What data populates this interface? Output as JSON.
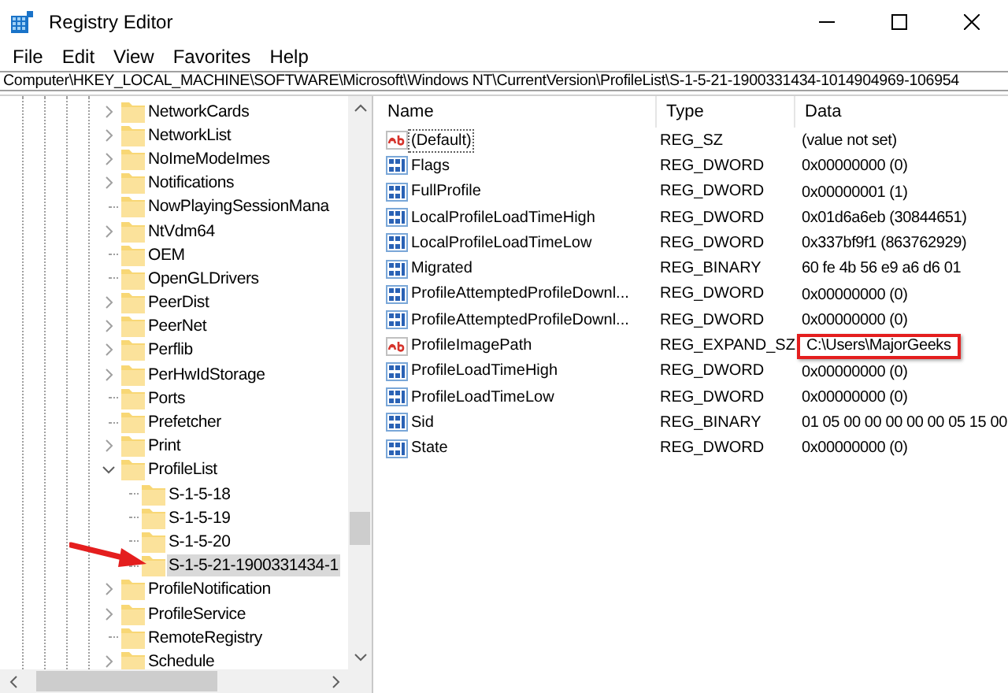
{
  "window": {
    "title": "Registry Editor"
  },
  "menu": [
    "File",
    "Edit",
    "View",
    "Favorites",
    "Help"
  ],
  "address": "Computer\\HKEY_LOCAL_MACHINE\\SOFTWARE\\Microsoft\\Windows NT\\CurrentVersion\\ProfileList\\S-1-5-21-1900331434-1014904969-106954",
  "tree": [
    {
      "label": "NetworkCards",
      "expanded": false,
      "selected": false
    },
    {
      "label": "NetworkList",
      "expanded": false,
      "selected": false
    },
    {
      "label": "NoImeModeImes",
      "expanded": false,
      "selected": false
    },
    {
      "label": "Notifications",
      "expanded": false,
      "selected": false
    },
    {
      "label": "NowPlayingSessionMana",
      "selected": false
    },
    {
      "label": "NtVdm64",
      "expanded": false,
      "selected": false
    },
    {
      "label": "OEM",
      "selected": false
    },
    {
      "label": "OpenGLDrivers",
      "selected": false
    },
    {
      "label": "PeerDist",
      "expanded": false,
      "selected": false
    },
    {
      "label": "PeerNet",
      "expanded": false,
      "selected": false
    },
    {
      "label": "Perflib",
      "expanded": false,
      "selected": false
    },
    {
      "label": "PerHwIdStorage",
      "expanded": false,
      "selected": false
    },
    {
      "label": "Ports",
      "selected": false
    },
    {
      "label": "Prefetcher",
      "selected": false
    },
    {
      "label": "Print",
      "expanded": false,
      "selected": false
    },
    {
      "label": "ProfileList",
      "expanded": true,
      "selected": false,
      "children": [
        {
          "label": "S-1-5-18",
          "selected": false
        },
        {
          "label": "S-1-5-19",
          "selected": false
        },
        {
          "label": "S-1-5-20",
          "selected": false
        },
        {
          "label": "S-1-5-21-1900331434-1",
          "selected": true
        }
      ]
    },
    {
      "label": "ProfileNotification",
      "expanded": false,
      "selected": false
    },
    {
      "label": "ProfileService",
      "expanded": false,
      "selected": false
    },
    {
      "label": "RemoteRegistry",
      "selected": false
    },
    {
      "label": "Schedule",
      "expanded": false,
      "selected": false
    }
  ],
  "annotations": [
    {
      "kind": "arrow"
    }
  ],
  "values": {
    "columns": [
      "Name",
      "Type",
      "Data"
    ],
    "rows": [
      {
        "kind": "string",
        "name": "(Default)",
        "type": "REG_SZ",
        "data": "(value not set)",
        "focused": true,
        "highlighted": false
      },
      {
        "kind": "binary",
        "name": "Flags",
        "type": "REG_DWORD",
        "data": "0x00000000 (0)",
        "focused": false,
        "highlighted": false
      },
      {
        "kind": "binary",
        "name": "FullProfile",
        "type": "REG_DWORD",
        "data": "0x00000001 (1)",
        "focused": false,
        "highlighted": false
      },
      {
        "kind": "binary",
        "name": "LocalProfileLoadTimeHigh",
        "type": "REG_DWORD",
        "data": "0x01d6a6eb (30844651)",
        "focused": false,
        "highlighted": false
      },
      {
        "kind": "binary",
        "name": "LocalProfileLoadTimeLow",
        "type": "REG_DWORD",
        "data": "0x337bf9f1 (863762929)",
        "focused": false,
        "highlighted": false
      },
      {
        "kind": "binary",
        "name": "Migrated",
        "type": "REG_BINARY",
        "data": "60 fe 4b 56 e9 a6 d6 01",
        "focused": false,
        "highlighted": false
      },
      {
        "kind": "binary",
        "name": "ProfileAttemptedProfileDownl...",
        "type": "REG_DWORD",
        "data": "0x00000000 (0)",
        "focused": false,
        "highlighted": false
      },
      {
        "kind": "binary",
        "name": "ProfileAttemptedProfileDownl...",
        "type": "REG_DWORD",
        "data": "0x00000000 (0)",
        "focused": false,
        "highlighted": false
      },
      {
        "kind": "string",
        "name": "ProfileImagePath",
        "type": "REG_EXPAND_SZ",
        "data": "C:\\Users\\MajorGeeks",
        "focused": false,
        "highlighted": true
      },
      {
        "kind": "binary",
        "name": "ProfileLoadTimeHigh",
        "type": "REG_DWORD",
        "data": "0x00000000 (0)",
        "focused": false,
        "highlighted": false
      },
      {
        "kind": "binary",
        "name": "ProfileLoadTimeLow",
        "type": "REG_DWORD",
        "data": "0x00000000 (0)",
        "focused": false,
        "highlighted": false
      },
      {
        "kind": "binary",
        "name": "Sid",
        "type": "REG_BINARY",
        "data": "01 05 00 00 00 00 00 05 15 00",
        "focused": false,
        "highlighted": false
      },
      {
        "kind": "binary",
        "name": "State",
        "type": "REG_DWORD",
        "data": "0x00000000 (0)",
        "focused": false,
        "highlighted": false
      }
    ]
  }
}
